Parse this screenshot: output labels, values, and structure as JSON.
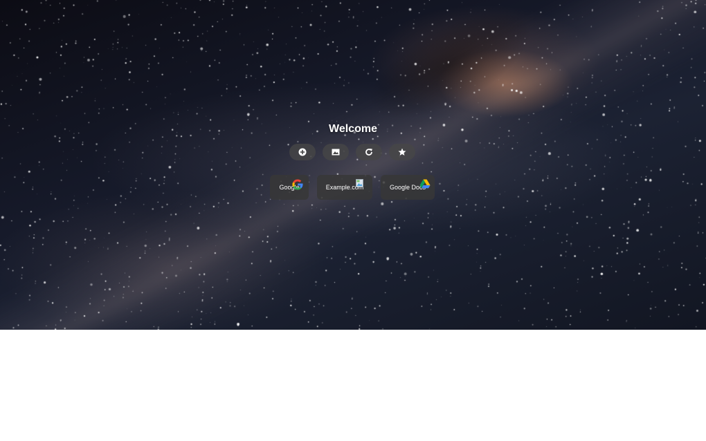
{
  "hero": {
    "welcome_text": "Welcome"
  },
  "toolbar": {
    "buttons": [
      {
        "icon": "add-circle-icon"
      },
      {
        "icon": "image-icon"
      },
      {
        "icon": "refresh-icon"
      },
      {
        "icon": "star-icon"
      }
    ]
  },
  "links": [
    {
      "label": "Google",
      "icon": "google-icon"
    },
    {
      "label": "Example.com",
      "icon": "broken-image-icon"
    },
    {
      "label": "Google Docs",
      "icon": "google-drive-icon"
    }
  ]
}
